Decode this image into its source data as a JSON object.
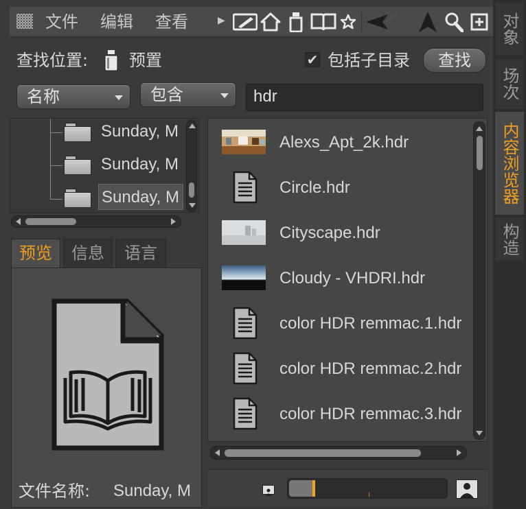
{
  "menubar": {
    "items": [
      "文件",
      "编辑",
      "查看"
    ],
    "overflow_icon": "triangle-right-icon",
    "tools": [
      "pencil-icon",
      "home-icon",
      "bottle-icon",
      "book-icon",
      "star-icon",
      "arrow-left-icon",
      "arrow-up-icon",
      "magnifier-icon",
      "add-icon"
    ]
  },
  "search": {
    "location_label": "查找位置:",
    "location_value": "预置",
    "include_subdirs_label": "包括子目录",
    "include_subdirs_checked": "✔",
    "find_button": "查找",
    "field_dropdown": "名称",
    "match_dropdown": "包含",
    "query": "hdr"
  },
  "tree": {
    "items": [
      "Sunday, M",
      "Sunday, M",
      "Sunday, M"
    ],
    "selected_index": 2
  },
  "info_tabs": {
    "tabs": [
      "预览",
      "信息",
      "语言"
    ],
    "active": 0
  },
  "preview": {
    "filename_label": "文件名称:",
    "filename_value": "Sunday, M"
  },
  "files": [
    {
      "name": "Alexs_Apt_2k.hdr",
      "thumb": "panorama-interior"
    },
    {
      "name": "Circle.hdr",
      "thumb": "document-icon"
    },
    {
      "name": "Cityscape.hdr",
      "thumb": "panorama-city"
    },
    {
      "name": "Cloudy - VHDRI.hdr",
      "thumb": "panorama-sky"
    },
    {
      "name": "color HDR remmac.1.hdr",
      "thumb": "document-icon"
    },
    {
      "name": "color HDR remmac.2.hdr",
      "thumb": "document-icon"
    },
    {
      "name": "color HDR remmac.3.hdr",
      "thumb": "document-icon"
    }
  ],
  "side_tabs": {
    "tabs": [
      "对象",
      "场次",
      "内容浏览器",
      "构造"
    ],
    "active": 2
  },
  "accent_color": "#f0a020"
}
